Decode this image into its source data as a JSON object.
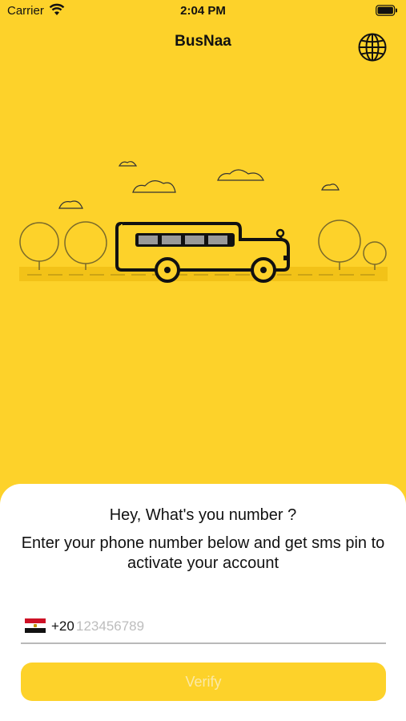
{
  "status_bar": {
    "carrier": "Carrier",
    "time": "2:04 PM"
  },
  "nav": {
    "title": "BusNaa",
    "language_icon": "globe-icon"
  },
  "illustration": {
    "description_icon": "school-bus-icon"
  },
  "sheet": {
    "heading": "Hey, What's you number ?",
    "subtitle": "Enter your phone number below and get sms pin to activate your account",
    "country_flag_icon": "egypt-flag-icon",
    "country_code": "+20",
    "phone_placeholder": "123456789",
    "phone_value": "",
    "verify_label": "Verify"
  },
  "colors": {
    "background": "#FDD22A",
    "sheet": "#FFFFFF",
    "button": "#FDD22A",
    "button_text": "#FBE9A6"
  }
}
